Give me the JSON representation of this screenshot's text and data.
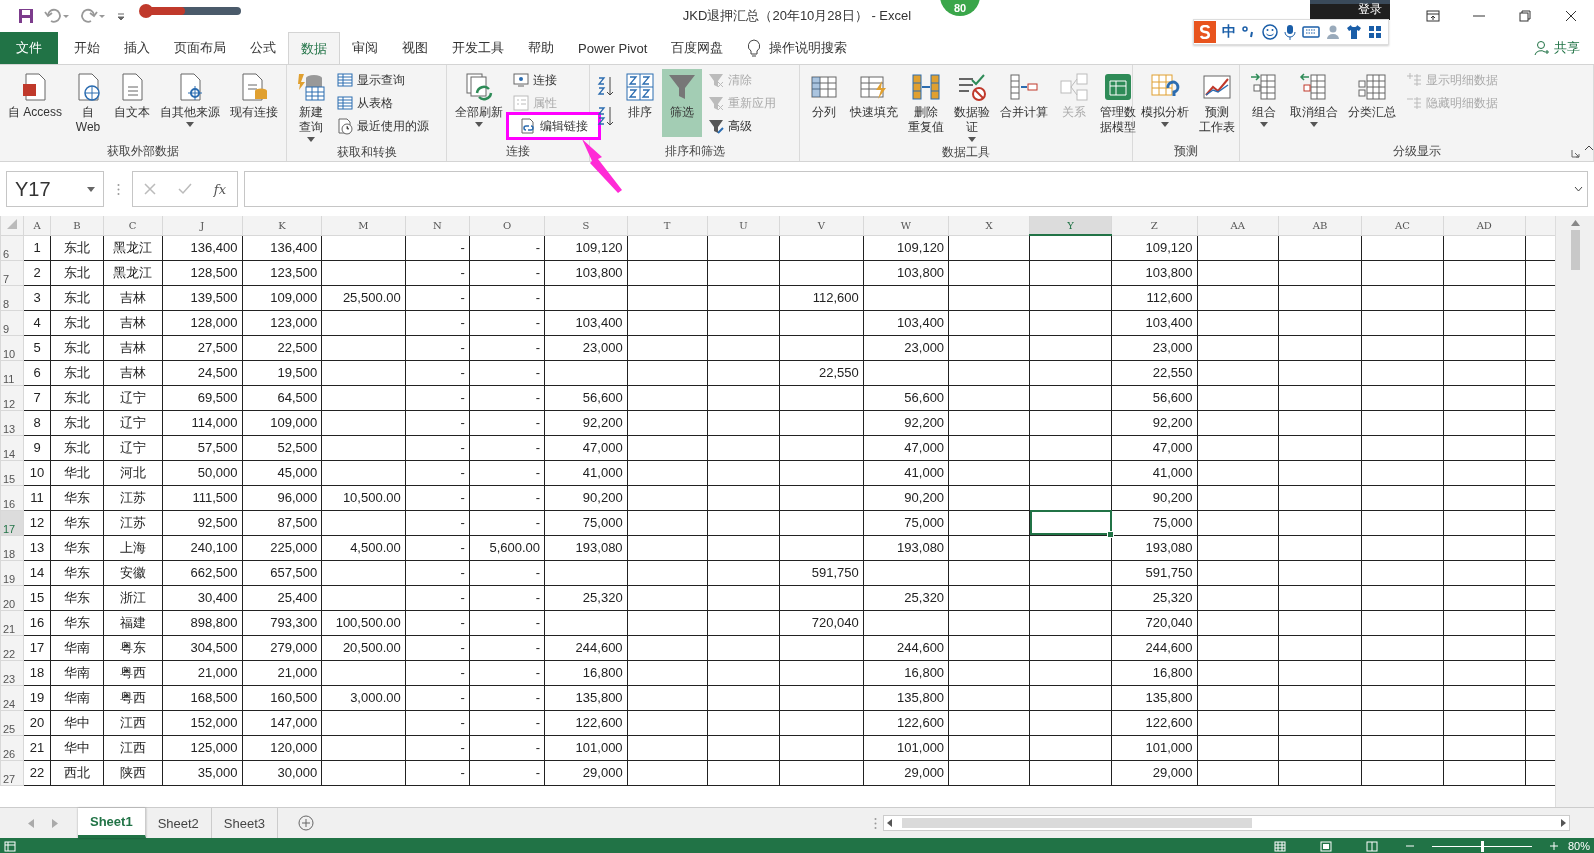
{
  "window": {
    "title": "JKD退押汇总（20年10月28日） - Excel",
    "badge": "80",
    "account_button": "登录"
  },
  "ime_toolbar": {
    "mode": "中"
  },
  "tabs": [
    {
      "label": "文件",
      "kind": "file",
      "selected": false
    },
    {
      "label": "开始",
      "kind": "tab",
      "selected": false
    },
    {
      "label": "插入",
      "kind": "tab",
      "selected": false
    },
    {
      "label": "页面布局",
      "kind": "tab",
      "selected": false
    },
    {
      "label": "公式",
      "kind": "tab",
      "selected": false
    },
    {
      "label": "数据",
      "kind": "tab",
      "selected": true
    },
    {
      "label": "审阅",
      "kind": "tab",
      "selected": false
    },
    {
      "label": "视图",
      "kind": "tab",
      "selected": false
    },
    {
      "label": "开发工具",
      "kind": "tab",
      "selected": false
    },
    {
      "label": "帮助",
      "kind": "tab",
      "selected": false
    },
    {
      "label": "Power Pivot",
      "kind": "tab",
      "selected": false
    },
    {
      "label": "百度网盘",
      "kind": "tab",
      "selected": false
    }
  ],
  "tell_me": "操作说明搜索",
  "share": "共享",
  "ribbon_groups": [
    {
      "label": "获取外部数据",
      "items": [
        {
          "kind": "large",
          "label": "自 Access"
        },
        {
          "kind": "large",
          "lines": [
            "自",
            "Web"
          ]
        },
        {
          "kind": "large",
          "label": "自文本"
        },
        {
          "kind": "large",
          "label": "自其他来源",
          "dropdown": true
        },
        {
          "kind": "large",
          "label": "现有连接"
        }
      ]
    },
    {
      "label": "获取和转换",
      "items": [
        {
          "kind": "large",
          "lines": [
            "新建",
            "查询"
          ],
          "dropdown": true
        },
        {
          "kind": "stack",
          "buttons": [
            {
              "label": "显示查询",
              "disabled": false
            },
            {
              "label": "从表格",
              "disabled": false
            },
            {
              "label": "最近使用的源",
              "disabled": false
            }
          ]
        }
      ]
    },
    {
      "label": "连接",
      "items": [
        {
          "kind": "large",
          "label": "全部刷新",
          "dropdown": true
        },
        {
          "kind": "stack",
          "buttons": [
            {
              "label": "连接",
              "disabled": false,
              "highlighted": false
            },
            {
              "label": "属性",
              "disabled": true,
              "highlighted": false
            },
            {
              "label": "编辑链接",
              "disabled": false,
              "highlighted": true
            }
          ]
        }
      ]
    },
    {
      "label": "排序和筛选",
      "items": [
        {
          "kind": "sort_icons"
        },
        {
          "kind": "large",
          "label": "排序"
        },
        {
          "kind": "large",
          "label": "筛选",
          "on": true
        },
        {
          "kind": "stack",
          "buttons": [
            {
              "label": "清除",
              "disabled": true
            },
            {
              "label": "重新应用",
              "disabled": true
            },
            {
              "label": "高级",
              "disabled": false
            }
          ]
        }
      ]
    },
    {
      "label": "数据工具",
      "items": [
        {
          "kind": "large",
          "label": "分列"
        },
        {
          "kind": "large",
          "label": "快速填充"
        },
        {
          "kind": "large",
          "lines": [
            "删除",
            "重复值"
          ]
        },
        {
          "kind": "large",
          "lines": [
            "数据验",
            "证"
          ],
          "dropdown": true
        },
        {
          "kind": "large",
          "label": "合并计算"
        },
        {
          "kind": "large",
          "label": "关系",
          "disabled": true
        },
        {
          "kind": "large",
          "lines": [
            "管理数",
            "据模型"
          ]
        }
      ]
    },
    {
      "label": "预测",
      "items": [
        {
          "kind": "large",
          "label": "模拟分析",
          "dropdown": true
        },
        {
          "kind": "large",
          "lines": [
            "预测",
            "工作表"
          ]
        }
      ]
    },
    {
      "label": "分级显示",
      "items": [
        {
          "kind": "large",
          "label": "组合",
          "dropdown": true
        },
        {
          "kind": "large",
          "label": "取消组合",
          "dropdown": true
        },
        {
          "kind": "large",
          "label": "分类汇总"
        },
        {
          "kind": "stack",
          "buttons": [
            {
              "label": "显示明细数据",
              "disabled": true
            },
            {
              "label": "隐藏明细数据",
              "disabled": true
            }
          ]
        }
      ]
    }
  ],
  "formula_bar": {
    "name_box": "Y17",
    "function_button": "fx"
  },
  "table": {
    "columns": [
      {
        "label": "A",
        "selected": false
      },
      {
        "label": "B",
        "selected": false
      },
      {
        "label": "C",
        "selected": false
      },
      {
        "label": "J",
        "selected": false
      },
      {
        "label": "K",
        "selected": false
      },
      {
        "label": "M",
        "selected": false
      },
      {
        "label": "N",
        "selected": false
      },
      {
        "label": "O",
        "selected": false
      },
      {
        "label": "S",
        "selected": false
      },
      {
        "label": "T",
        "selected": false
      },
      {
        "label": "U",
        "selected": false
      },
      {
        "label": "V",
        "selected": false
      },
      {
        "label": "W",
        "selected": false
      },
      {
        "label": "X",
        "selected": false
      },
      {
        "label": "Y",
        "selected": true
      },
      {
        "label": "Z",
        "selected": false
      },
      {
        "label": "AA",
        "selected": false
      },
      {
        "label": "AB",
        "selected": false
      },
      {
        "label": "AC",
        "selected": false
      },
      {
        "label": "AD",
        "selected": false
      }
    ],
    "rows": [
      {
        "number": "6",
        "selected": false,
        "cells": [
          "1",
          "东北",
          "黑龙江",
          "136,400",
          "136,400",
          null,
          "-",
          "-",
          "109,120",
          null,
          null,
          null,
          "109,120",
          null,
          null,
          "109,120"
        ]
      },
      {
        "number": "7",
        "selected": false,
        "cells": [
          "2",
          "东北",
          "黑龙江",
          "128,500",
          "123,500",
          null,
          "-",
          "-",
          "103,800",
          null,
          null,
          null,
          "103,800",
          null,
          null,
          "103,800"
        ]
      },
      {
        "number": "8",
        "selected": false,
        "cells": [
          "3",
          "东北",
          "吉林",
          "139,500",
          "109,000",
          "25,500.00",
          "-",
          "-",
          null,
          null,
          null,
          "112,600",
          null,
          null,
          null,
          "112,600"
        ]
      },
      {
        "number": "9",
        "selected": false,
        "cells": [
          "4",
          "东北",
          "吉林",
          "128,000",
          "123,000",
          null,
          "-",
          "-",
          "103,400",
          null,
          null,
          null,
          "103,400",
          null,
          null,
          "103,400"
        ]
      },
      {
        "number": "10",
        "selected": false,
        "cells": [
          "5",
          "东北",
          "吉林",
          "27,500",
          "22,500",
          null,
          "-",
          "-",
          "23,000",
          null,
          null,
          null,
          "23,000",
          null,
          null,
          "23,000"
        ]
      },
      {
        "number": "11",
        "selected": false,
        "cells": [
          "6",
          "东北",
          "吉林",
          "24,500",
          "19,500",
          null,
          "-",
          "-",
          null,
          null,
          null,
          "22,550",
          null,
          null,
          null,
          "22,550"
        ]
      },
      {
        "number": "12",
        "selected": false,
        "cells": [
          "7",
          "东北",
          "辽宁",
          "69,500",
          "64,500",
          null,
          "-",
          "-",
          "56,600",
          null,
          null,
          null,
          "56,600",
          null,
          null,
          "56,600"
        ]
      },
      {
        "number": "13",
        "selected": false,
        "cells": [
          "8",
          "东北",
          "辽宁",
          "114,000",
          "109,000",
          null,
          "-",
          "-",
          "92,200",
          null,
          null,
          null,
          "92,200",
          null,
          null,
          "92,200"
        ]
      },
      {
        "number": "14",
        "selected": false,
        "cells": [
          "9",
          "东北",
          "辽宁",
          "57,500",
          "52,500",
          null,
          "-",
          "-",
          "47,000",
          null,
          null,
          null,
          "47,000",
          null,
          null,
          "47,000"
        ]
      },
      {
        "number": "15",
        "selected": false,
        "cells": [
          "10",
          "华北",
          "河北",
          "50,000",
          "45,000",
          null,
          "-",
          "-",
          "41,000",
          null,
          null,
          null,
          "41,000",
          null,
          null,
          "41,000"
        ]
      },
      {
        "number": "16",
        "selected": false,
        "cells": [
          "11",
          "华东",
          "江苏",
          "111,500",
          "96,000",
          "10,500.00",
          "-",
          "-",
          "90,200",
          null,
          null,
          null,
          "90,200",
          null,
          null,
          "90,200"
        ]
      },
      {
        "number": "17",
        "selected": true,
        "cells": [
          "12",
          "华东",
          "江苏",
          "92,500",
          "87,500",
          null,
          "-",
          "-",
          "75,000",
          null,
          null,
          null,
          "75,000",
          null,
          null,
          "75,000"
        ]
      },
      {
        "number": "18",
        "selected": false,
        "cells": [
          "13",
          "华东",
          "上海",
          "240,100",
          "225,000",
          "4,500.00",
          "-",
          "5,600.00",
          "193,080",
          null,
          null,
          null,
          "193,080",
          null,
          null,
          "193,080"
        ]
      },
      {
        "number": "19",
        "selected": false,
        "cells": [
          "14",
          "华东",
          "安徽",
          "662,500",
          "657,500",
          null,
          "-",
          "-",
          null,
          null,
          null,
          "591,750",
          null,
          null,
          null,
          "591,750"
        ]
      },
      {
        "number": "20",
        "selected": false,
        "cells": [
          "15",
          "华东",
          "浙江",
          "30,400",
          "25,400",
          null,
          "-",
          "-",
          "25,320",
          null,
          null,
          null,
          "25,320",
          null,
          null,
          "25,320"
        ]
      },
      {
        "number": "21",
        "selected": false,
        "cells": [
          "16",
          "华东",
          "福建",
          "898,800",
          "793,300",
          "100,500.00",
          "-",
          "-",
          null,
          null,
          null,
          "720,040",
          null,
          null,
          null,
          "720,040"
        ]
      },
      {
        "number": "22",
        "selected": false,
        "cells": [
          "17",
          "华南",
          "粤东",
          "304,500",
          "279,000",
          "20,500.00",
          "-",
          "-",
          "244,600",
          null,
          null,
          null,
          "244,600",
          null,
          null,
          "244,600"
        ]
      },
      {
        "number": "23",
        "selected": false,
        "cells": [
          "18",
          "华南",
          "粤西",
          "21,000",
          "21,000",
          null,
          "-",
          "-",
          "16,800",
          null,
          null,
          null,
          "16,800",
          null,
          null,
          "16,800"
        ]
      },
      {
        "number": "24",
        "selected": false,
        "cells": [
          "19",
          "华南",
          "粤西",
          "168,500",
          "160,500",
          "3,000.00",
          "-",
          "-",
          "135,800",
          null,
          null,
          null,
          "135,800",
          null,
          null,
          "135,800"
        ]
      },
      {
        "number": "25",
        "selected": false,
        "cells": [
          "20",
          "华中",
          "江西",
          "152,000",
          "147,000",
          null,
          "-",
          "-",
          "122,600",
          null,
          null,
          null,
          "122,600",
          null,
          null,
          "122,600"
        ]
      },
      {
        "number": "26",
        "selected": false,
        "cells": [
          "21",
          "华中",
          "江西",
          "125,000",
          "120,000",
          null,
          "-",
          "-",
          "101,000",
          null,
          null,
          null,
          "101,000",
          null,
          null,
          "101,000"
        ]
      },
      {
        "number": "27",
        "selected": false,
        "cells": [
          "22",
          "西北",
          "陕西",
          "35,000",
          "30,000",
          null,
          "-",
          "-",
          "29,000",
          null,
          null,
          null,
          "29,000",
          null,
          null,
          "29,000"
        ]
      }
    ]
  },
  "sheet_tabs": [
    {
      "label": "Sheet1",
      "selected": true
    },
    {
      "label": "Sheet2",
      "selected": false
    },
    {
      "label": "Sheet3",
      "selected": false
    }
  ],
  "status_bar": {
    "zoom": {
      "reading": "80%",
      "level": 0.5
    }
  }
}
